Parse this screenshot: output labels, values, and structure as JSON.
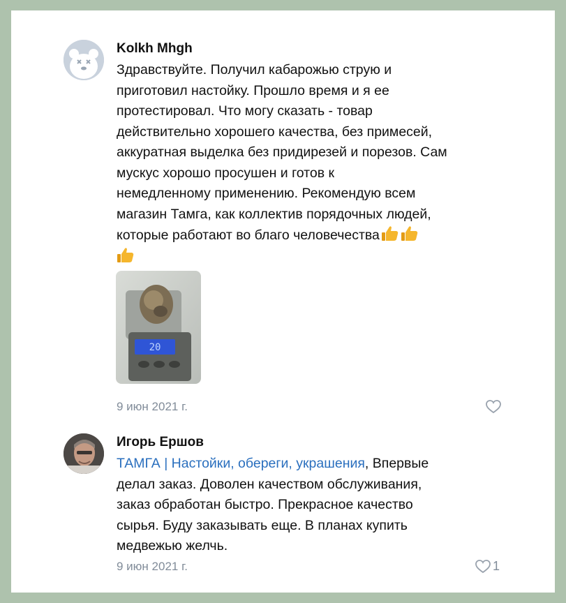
{
  "comments": [
    {
      "author": "Kolkh Mhgh",
      "text_lines": [
        "Здравствуйте. Получил кабарожью струю и",
        "приготовил настойку. Прошло время и я ее",
        "протестировал. Что могу сказать - товар",
        "действительно хорошего качества, без примесей,",
        "аккуратная выделка без придирезей и порезов. Сам",
        "мускус хорошо просушен и готов к",
        "немедленному применению. Рекомендую всем",
        "магазин Тамга, как коллектив порядочных людей,",
        "которые работают во благо человечества"
      ],
      "photo_display": "20",
      "date": "9 июн 2021 г.",
      "likes": ""
    },
    {
      "author": "Игорь Ершов",
      "mention": "ТАМГА | Настойки, обереги, украшения",
      "text_first_rest": ", Впервые",
      "text_lines": [
        "делал заказ. Доволен качеством обслуживания,",
        "заказ обработан быстро. Прекрасное качество",
        "сырья. Буду заказывать еще. В планах купить",
        "медвежью желчь."
      ],
      "date": "9 июн 2021 г.",
      "likes": "1"
    }
  ],
  "colors": {
    "link": "#2a6fbe",
    "meta": "#818c99",
    "frame": "#aec2ad"
  },
  "icons": [
    "bear-avatar-icon",
    "thumbs-up-icon",
    "heart-icon"
  ]
}
